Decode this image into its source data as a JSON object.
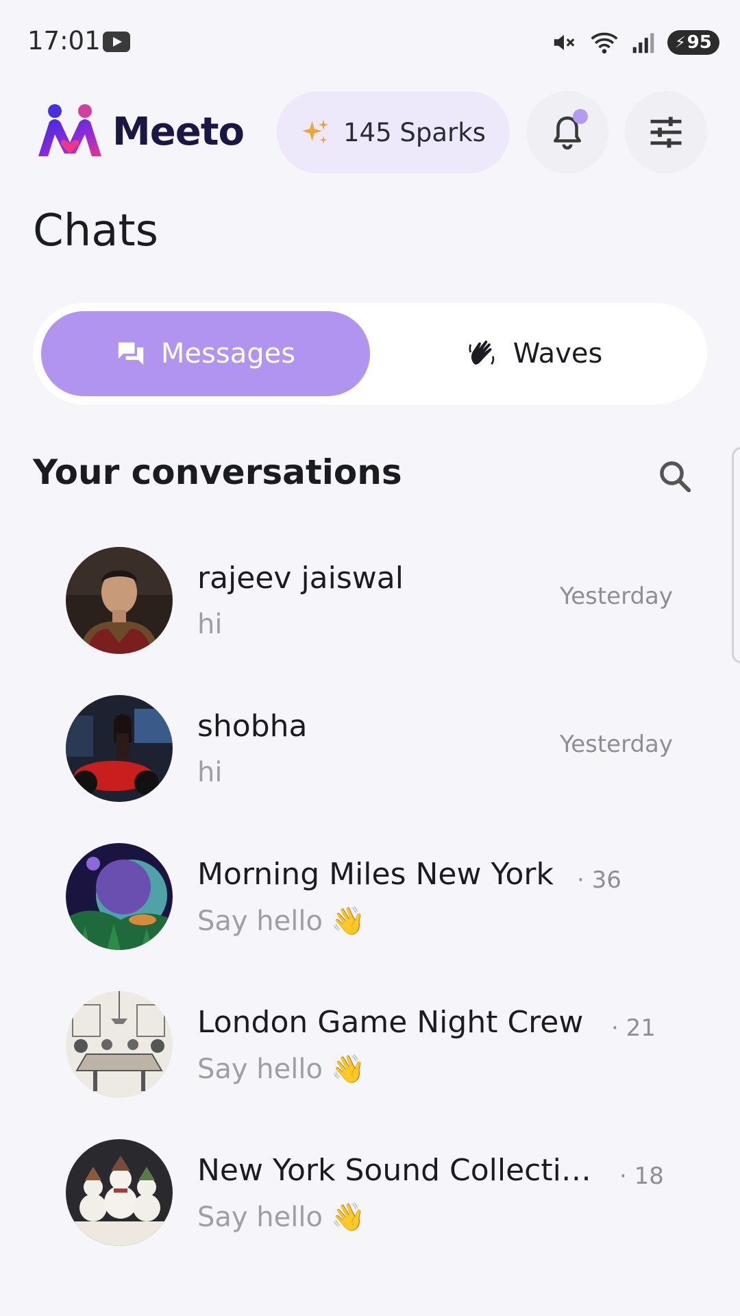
{
  "status_bar": {
    "time": "17:01",
    "battery": "95"
  },
  "header": {
    "logo_text": "Meeto",
    "sparks_label": "145 Sparks"
  },
  "page": {
    "title": "Chats"
  },
  "tabs": [
    {
      "label": "Messages",
      "active": true,
      "icon": "chat-bubbles-icon"
    },
    {
      "label": "Waves",
      "active": false,
      "icon": "waving-hand-icon"
    }
  ],
  "section": {
    "title": "Your conversations"
  },
  "conversations": [
    {
      "name": "rajeev jaiswal",
      "preview": "hi",
      "time": "Yesterday",
      "count": "",
      "avatar": "warrior-man-avatar"
    },
    {
      "name": "shobha",
      "preview": "hi",
      "time": "Yesterday",
      "count": "",
      "avatar": "woman-motorcycle-avatar"
    },
    {
      "name": "Morning Miles New York",
      "preview": "Say hello",
      "time": "",
      "count": "· 36",
      "avatar": "space-planet-avatar"
    },
    {
      "name": "London Game Night Crew",
      "preview": "Say hello",
      "time": "",
      "count": "· 21",
      "avatar": "meeting-sketch-avatar"
    },
    {
      "name": "New York Sound Collecti…",
      "preview": "Say hello",
      "time": "",
      "count": "· 18",
      "avatar": "snowmen-avatar"
    }
  ],
  "colors": {
    "background": "#F6F5FA",
    "accent": "#B194F0",
    "sparks_bg": "#EEE8FB",
    "sparkle": "#E8A93A",
    "brand_dark": "#1A1744"
  }
}
